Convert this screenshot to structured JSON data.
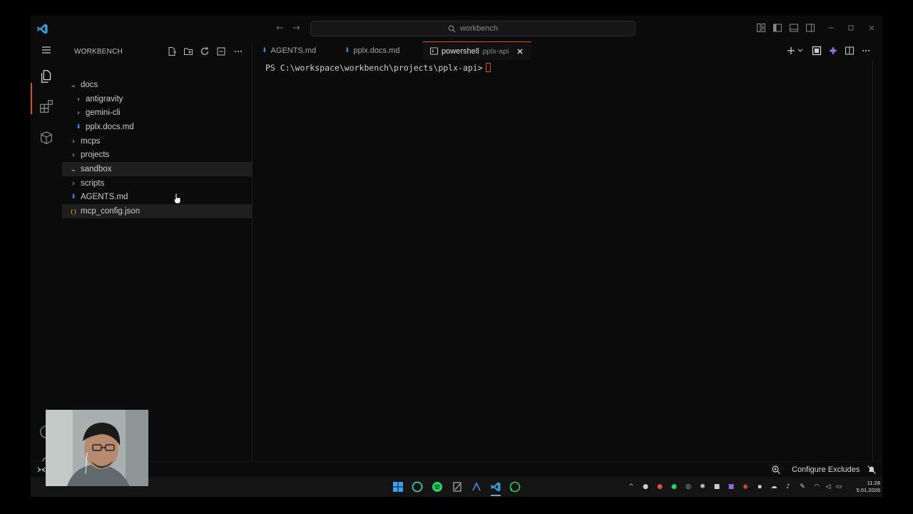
{
  "titlebar": {
    "search_text": "workbench",
    "back_icon": "arrow-left-icon",
    "forward_icon": "arrow-right-icon",
    "window_controls": [
      "minimize",
      "restore",
      "close"
    ]
  },
  "activitybar": {
    "items": [
      "explorer-icon",
      "extensions-icon",
      "package-icon"
    ],
    "bottom": [
      "account-icon",
      "settings-icon"
    ]
  },
  "sidebar": {
    "title": "WORKBENCH",
    "tree": [
      {
        "label": "docs",
        "type": "folder",
        "expanded": true
      },
      {
        "label": "antigravity",
        "type": "folder",
        "expanded": false
      },
      {
        "label": "gemini-cli",
        "type": "folder",
        "expanded": false
      },
      {
        "label": "pplx.docs.md",
        "type": "md"
      },
      {
        "label": "mcps",
        "type": "folder",
        "expanded": false
      },
      {
        "label": "projects",
        "type": "folder",
        "expanded": false
      },
      {
        "label": "sandbox",
        "type": "folder",
        "expanded": true
      },
      {
        "label": "scripts",
        "type": "folder",
        "expanded": false
      },
      {
        "label": "AGENTS.md",
        "type": "md"
      },
      {
        "label": "mcp_config.json",
        "type": "json"
      }
    ]
  },
  "tabs": [
    {
      "label": "AGENTS.md",
      "icon": "markdown-icon"
    },
    {
      "label": "pplx.docs.md",
      "icon": "markdown-icon"
    },
    {
      "label": "powershell",
      "desc": "pplx-api",
      "icon": "terminal-icon",
      "active": true
    }
  ],
  "terminal": {
    "prompt": "PS C:\\workspace\\workbench\\projects\\pplx-api>"
  },
  "statusbar": {
    "configure_label": "Configure Excludes"
  },
  "taskbar": {
    "time": "11:28",
    "date": "5.01.2026"
  },
  "colors": {
    "accent": "#d8501f",
    "background": "#0b0b0b",
    "vscode_blue": "#3c99d4"
  }
}
